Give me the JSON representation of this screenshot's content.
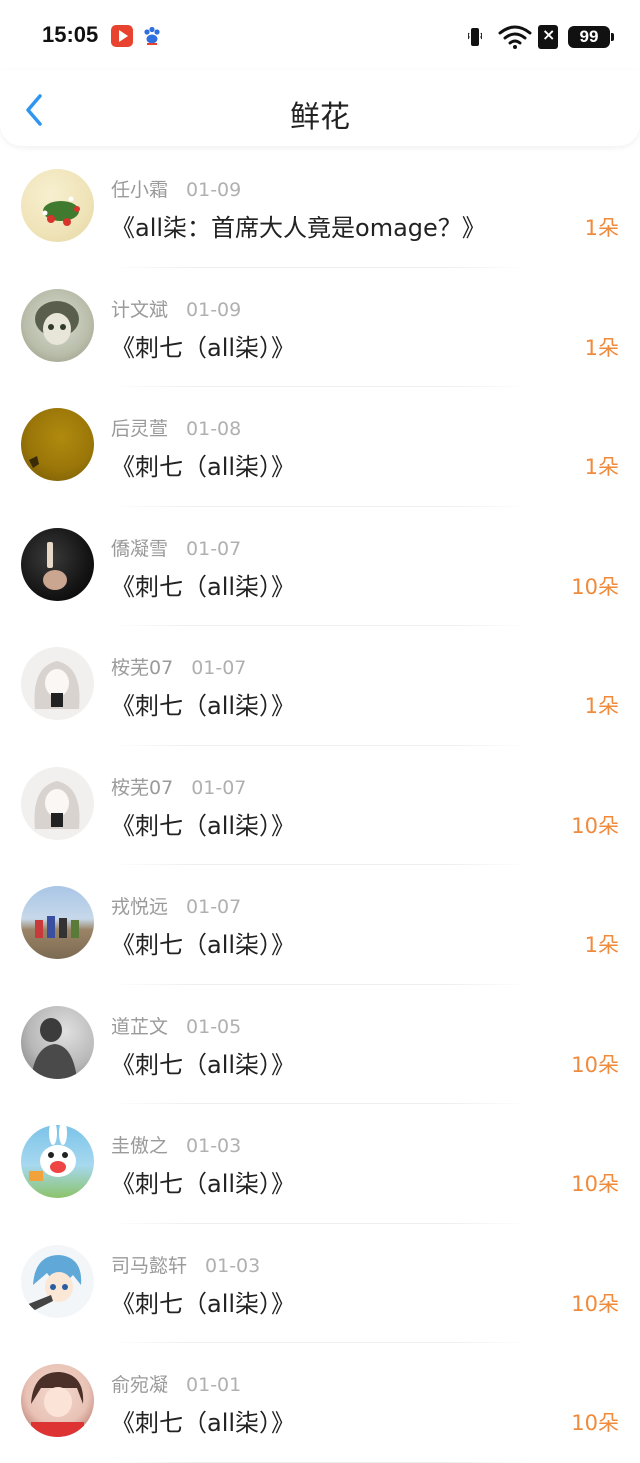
{
  "status_bar": {
    "time": "15:05",
    "battery": "99",
    "icons": [
      "video-app-icon",
      "paw-app-icon",
      "vibrate-icon",
      "wifi-icon",
      "sim-icon",
      "battery-icon"
    ]
  },
  "header": {
    "title": "鲜花",
    "back_icon": "chevron-left-icon"
  },
  "colors": {
    "accent_back": "#2f96f0",
    "count_orange": "#f08a3c",
    "meta_gray": "#9a9a9a"
  },
  "rows": [
    {
      "name": "任小霜",
      "date": "01-09",
      "book": "《all柒：首席大人竟是omage？》",
      "count": "1朵"
    },
    {
      "name": "计文斌",
      "date": "01-09",
      "book": "《刺七（all柒）》",
      "count": "1朵"
    },
    {
      "name": "后灵萱",
      "date": "01-08",
      "book": "《刺七（all柒）》",
      "count": "1朵"
    },
    {
      "name": "僑凝雪",
      "date": "01-07",
      "book": "《刺七（all柒）》",
      "count": "10朵"
    },
    {
      "name": "桉芜07",
      "date": "01-07",
      "book": "《刺七（all柒）》",
      "count": "1朵"
    },
    {
      "name": "桉芜07",
      "date": "01-07",
      "book": "《刺七（all柒）》",
      "count": "10朵"
    },
    {
      "name": "戎悦远",
      "date": "01-07",
      "book": "《刺七（all柒）》",
      "count": "1朵"
    },
    {
      "name": "道芷文",
      "date": "01-05",
      "book": "《刺七（all柒）》",
      "count": "10朵"
    },
    {
      "name": "圭傲之",
      "date": "01-03",
      "book": "《刺七（all柒）》",
      "count": "10朵"
    },
    {
      "name": "司马懿轩",
      "date": "01-03",
      "book": "《刺七（all柒）》",
      "count": "10朵"
    },
    {
      "name": "俞宛凝",
      "date": "01-01",
      "book": "《刺七（all柒）》",
      "count": "10朵"
    }
  ]
}
